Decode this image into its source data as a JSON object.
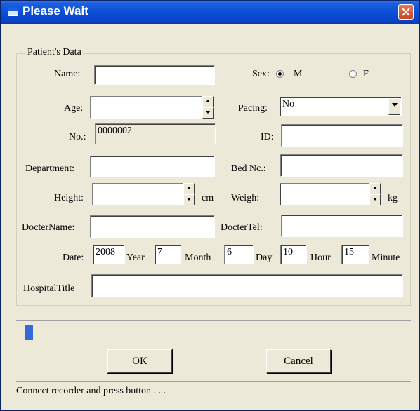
{
  "window": {
    "title": "Please Wait"
  },
  "group": {
    "legend": "Patient's Data"
  },
  "form": {
    "name_label": "Name:",
    "name_value": "",
    "sex_label": "Sex:",
    "sex_m": "M",
    "sex_f": "F",
    "sex_selected": "M",
    "age_label": "Age:",
    "age_value": "",
    "pacing_label": "Pacing:",
    "pacing_value": "No",
    "no_label": "No.:",
    "no_value": "0000002",
    "id_label": "ID:",
    "id_value": "",
    "department_label": "Department:",
    "department_value": "",
    "bed_label": "Bed Nc.:",
    "bed_value": "",
    "height_label": "Height:",
    "height_value": "",
    "height_unit": "cm",
    "weight_label": "Weigh:",
    "weight_value": "",
    "weight_unit": "kg",
    "doctor_name_label": "DocterName:",
    "doctor_name_value": "",
    "doctor_tel_label": "DocterTel:",
    "doctor_tel_value": "",
    "date_label": "Date:",
    "year_value": "2008",
    "year_label": "Year",
    "month_value": "7",
    "month_label": "Month",
    "day_value": "6",
    "day_label": "Day",
    "hour_value": "10",
    "hour_label": "Hour",
    "minute_value": "15",
    "minute_label": "Minute",
    "hospital_title_label": "HospitalTitle",
    "hospital_title_value": ""
  },
  "progress": {
    "fraction": 0.02
  },
  "buttons": {
    "ok": "OK",
    "cancel": "Cancel"
  },
  "status": {
    "text": "Connect recorder and press button . . ."
  },
  "icons": {
    "title": "window-icon",
    "close": "close-icon"
  },
  "colors": {
    "titlebar": "#0a4fd6",
    "progress": "#3469d6",
    "dialog_bg": "#ece9d8"
  }
}
